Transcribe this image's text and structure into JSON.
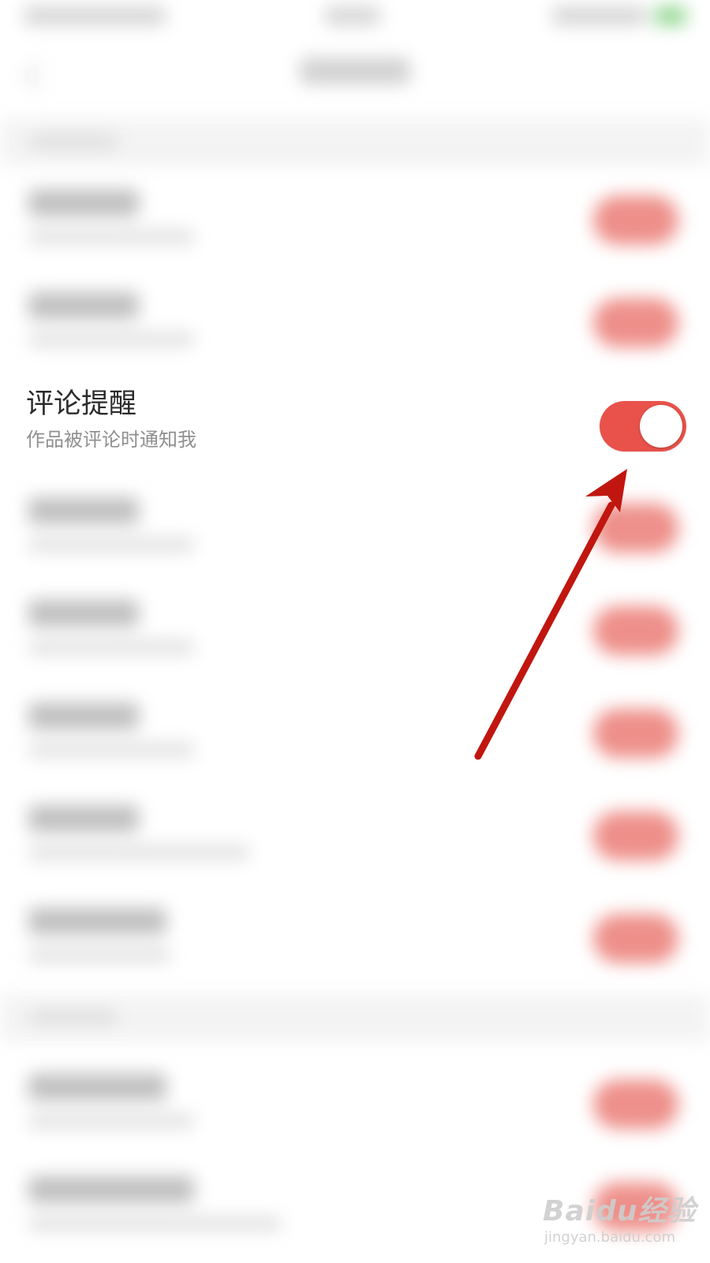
{
  "settings": {
    "comment_reminder": {
      "title": "评论提醒",
      "subtitle": "作品被评论时通知我",
      "enabled": true
    }
  },
  "colors": {
    "toggle_on": "#e8524a",
    "annotation_arrow": "#c0160f",
    "title_text": "#2b2b2b",
    "subtitle_text": "#8f8f8f"
  },
  "watermark": {
    "logo": "Baidu经验",
    "url": "jingyan.baidu.com"
  }
}
